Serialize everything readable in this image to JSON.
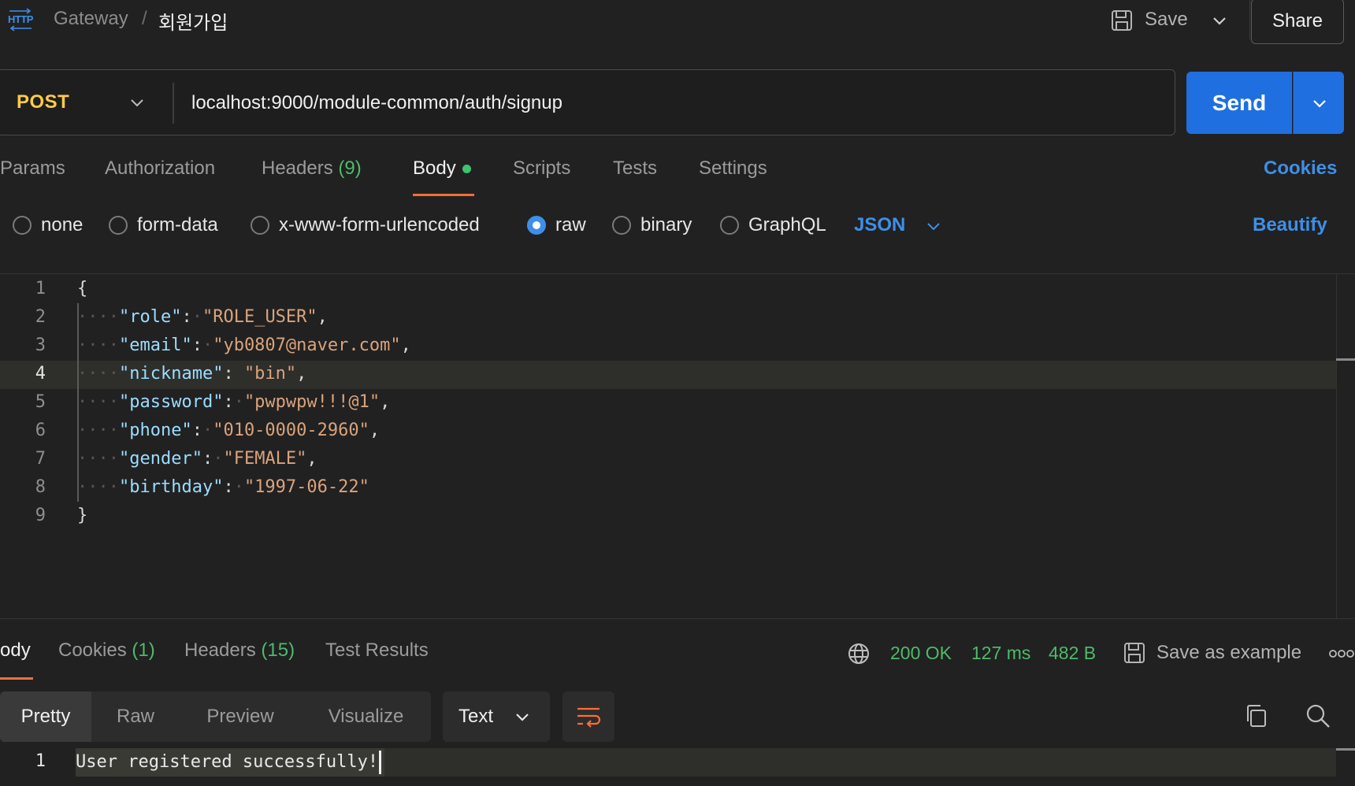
{
  "breadcrumb": {
    "collection": "Gateway",
    "separator": "/",
    "request": "회원가입"
  },
  "toolbar": {
    "save_label": "Save",
    "share_label": "Share"
  },
  "request": {
    "method": "POST",
    "url": "localhost:9000/module-common/auth/signup",
    "send_label": "Send"
  },
  "request_tabs": {
    "params": "Params",
    "authorization": "Authorization",
    "headers": "Headers",
    "headers_count": "(9)",
    "body": "Body",
    "scripts": "Scripts",
    "tests": "Tests",
    "settings": "Settings",
    "cookies": "Cookies",
    "active": "Body"
  },
  "body_types": {
    "none": "none",
    "form_data": "form-data",
    "urlencoded": "x-www-form-urlencoded",
    "raw": "raw",
    "binary": "binary",
    "graphql": "GraphQL",
    "selected": "raw",
    "language": "JSON",
    "beautify": "Beautify"
  },
  "editor": {
    "line_numbers": [
      "1",
      "2",
      "3",
      "4",
      "5",
      "6",
      "7",
      "8",
      "9"
    ],
    "open_brace": "{",
    "close_brace": "}",
    "fields": [
      {
        "key": "\"role\"",
        "value": "\"ROLE_USER\"",
        "trail": ","
      },
      {
        "key": "\"email\"",
        "value": "\"yb0807@naver.com\"",
        "trail": ","
      },
      {
        "key": "\"nickname\"",
        "value": "\"bin\"",
        "trail": ","
      },
      {
        "key": "\"password\"",
        "value": "\"pwpwpw!!!@1\"",
        "trail": ","
      },
      {
        "key": "\"phone\"",
        "value": "\"010-0000-2960\"",
        "trail": ","
      },
      {
        "key": "\"gender\"",
        "value": "\"FEMALE\"",
        "trail": ","
      },
      {
        "key": "\"birthday\"",
        "value": "\"1997-06-22\"",
        "trail": ""
      }
    ],
    "active_line": "4"
  },
  "response": {
    "tabs": {
      "body": "ody",
      "cookies": "Cookies",
      "cookies_count": "(1)",
      "headers": "Headers",
      "headers_count": "(15)",
      "test_results": "Test Results"
    },
    "status": "200 OK",
    "time": "127 ms",
    "size": "482 B",
    "save_example": "Save as example",
    "views": {
      "pretty": "Pretty",
      "raw": "Raw",
      "preview": "Preview",
      "visualize": "Visualize",
      "active": "Pretty"
    },
    "format": "Text",
    "line_number": "1",
    "body_text": "User registered successfully!"
  },
  "colors": {
    "method": "#ffcb45",
    "send": "#1f6fe0",
    "accent_link": "#3e8fe8",
    "tab_underline": "#ff6c37",
    "status_ok": "#4cbb6b",
    "json_key": "#9cdcfe",
    "json_value": "#d9a37c"
  }
}
